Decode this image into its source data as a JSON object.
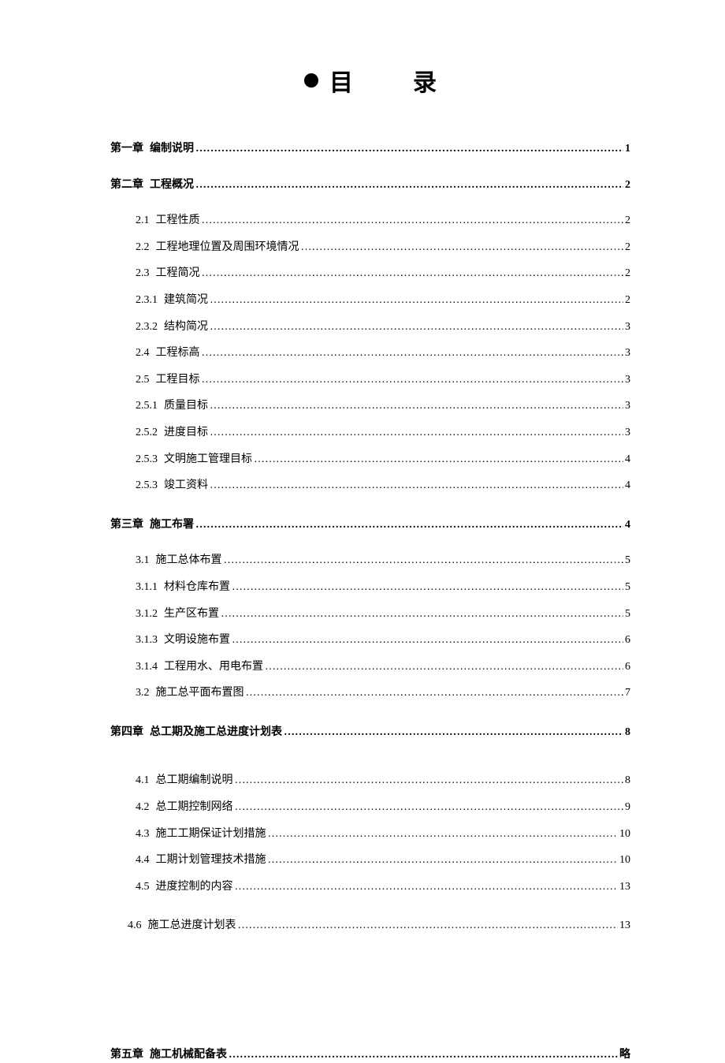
{
  "title": {
    "char1": "目",
    "char2": "录"
  },
  "lines": [
    {
      "kind": "chapter",
      "num": "第一章",
      "label": "编制说明",
      "page": "1"
    },
    {
      "kind": "chapter",
      "num": "第二章",
      "label": "工程概况",
      "page": "2"
    },
    {
      "kind": "sub",
      "num": "2.1",
      "label": "工程性质",
      "page": "2"
    },
    {
      "kind": "sub",
      "num": "2.2",
      "label": "工程地理位置及周围环境情况",
      "page": "2"
    },
    {
      "kind": "sub",
      "num": "2.3",
      "label": "工程简况",
      "page": "2"
    },
    {
      "kind": "sub",
      "num": "2.3.1",
      "label": "建筑简况",
      "page": "2"
    },
    {
      "kind": "sub",
      "num": "2.3.2",
      "label": "结构简况",
      "page": "3"
    },
    {
      "kind": "sub",
      "num": "2.4",
      "label": "工程标高",
      "page": "3"
    },
    {
      "kind": "sub",
      "num": "2.5",
      "label": "工程目标",
      "page": "3"
    },
    {
      "kind": "sub",
      "num": "2.5.1",
      "label": "质量目标",
      "page": "3"
    },
    {
      "kind": "sub",
      "num": "2.5.2",
      "label": "进度目标",
      "page": "3"
    },
    {
      "kind": "sub",
      "num": "2.5.3",
      "label": "文明施工管理目标",
      "page": "4"
    },
    {
      "kind": "sub",
      "num": "2.5.3",
      "label": "竣工资料",
      "page": "4"
    },
    {
      "kind": "gap"
    },
    {
      "kind": "chapter",
      "num": "第三章",
      "label": "施工布署",
      "page": "4"
    },
    {
      "kind": "sub",
      "num": "3.1",
      "label": "施工总体布置",
      "page": "5"
    },
    {
      "kind": "sub",
      "num": "3.1.1",
      "label": "材料仓库布置",
      "page": "5"
    },
    {
      "kind": "sub",
      "num": "3.1.2",
      "label": "生产区布置",
      "page": "5"
    },
    {
      "kind": "sub",
      "num": "3.1.3",
      "label": "文明设施布置",
      "page": "6"
    },
    {
      "kind": "sub",
      "num": "3.1.4",
      "label": "工程用水、用电布置",
      "page": "6"
    },
    {
      "kind": "sub",
      "num": "3.2",
      "label": "施工总平面布置图",
      "page": "7"
    },
    {
      "kind": "gap"
    },
    {
      "kind": "chapter",
      "num": "第四章",
      "label": "总工期及施工总进度计划表",
      "page": "8"
    },
    {
      "kind": "gap"
    },
    {
      "kind": "sub",
      "num": "4.1",
      "label": "总工期编制说明",
      "page": "8"
    },
    {
      "kind": "sub",
      "num": "4.2",
      "label": "总工期控制网络",
      "page": "9"
    },
    {
      "kind": "sub",
      "num": "4.3",
      "label": "施工工期保证计划措施",
      "page": "10"
    },
    {
      "kind": "sub",
      "num": "4.4",
      "label": "工期计划管理技术措施",
      "page": "10"
    },
    {
      "kind": "sub",
      "num": "4.5",
      "label": "进度控制的内容",
      "page": "13"
    },
    {
      "kind": "gap"
    },
    {
      "kind": "sub-alt",
      "num": "4.6",
      "label": "施工总进度计划表",
      "page": "13"
    },
    {
      "kind": "big-gap"
    },
    {
      "kind": "chapter",
      "num": "第五章",
      "label": "施工机械配备表",
      "page": "略"
    }
  ]
}
